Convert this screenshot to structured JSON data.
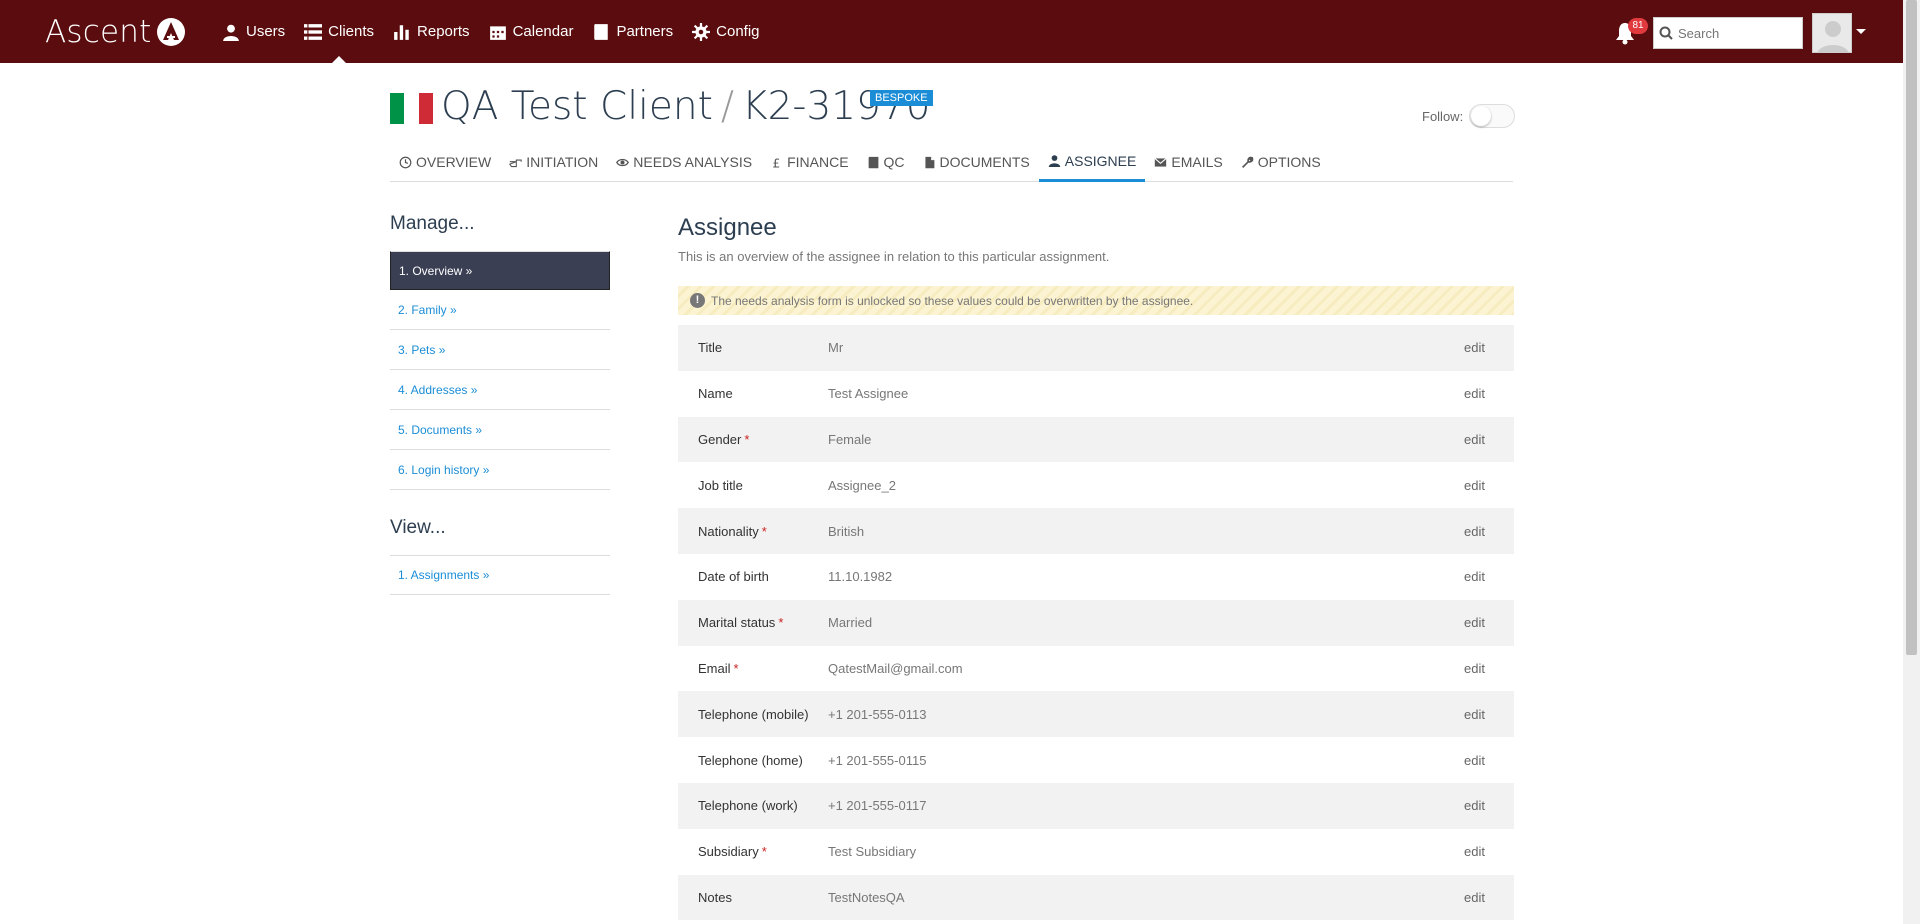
{
  "app": {
    "logo_text": "Ascent",
    "nav": [
      {
        "label": "Users",
        "icon": "user-icon"
      },
      {
        "label": "Clients",
        "icon": "list-icon"
      },
      {
        "label": "Reports",
        "icon": "bar-chart-icon"
      },
      {
        "label": "Calendar",
        "icon": "calendar-icon"
      },
      {
        "label": "Partners",
        "icon": "book-icon"
      },
      {
        "label": "Config",
        "icon": "gear-icon"
      }
    ],
    "active_nav": "Clients",
    "notifications_count": "81",
    "search_placeholder": "Search"
  },
  "header": {
    "client": "QA Test Client",
    "separator": "/",
    "case_ref": "K2-31970",
    "badge": "BESPOKE",
    "follow_label": "Follow:",
    "flag_colors": [
      "#009246",
      "#ffffff",
      "#ce2b37"
    ]
  },
  "tabs": [
    {
      "label": "OVERVIEW",
      "icon": "clock-icon"
    },
    {
      "label": "INITIATION",
      "icon": "hand-pointer-icon"
    },
    {
      "label": "NEEDS ANALYSIS",
      "icon": "eye-icon"
    },
    {
      "label": "FINANCE",
      "icon": "pound-icon"
    },
    {
      "label": "QC",
      "icon": "book-icon"
    },
    {
      "label": "DOCUMENTS",
      "icon": "file-icon"
    },
    {
      "label": "ASSIGNEE",
      "icon": "user-icon"
    },
    {
      "label": "EMAILS",
      "icon": "envelope-icon"
    },
    {
      "label": "OPTIONS",
      "icon": "wrench-icon"
    }
  ],
  "active_tab": "ASSIGNEE",
  "sidebar": {
    "manage_heading": "Manage...",
    "manage_items": [
      "1. Overview »",
      "2. Family »",
      "3. Pets »",
      "4. Addresses »",
      "5. Documents »",
      "6. Login history »"
    ],
    "view_heading": "View...",
    "view_items": [
      "1. Assignments »"
    ]
  },
  "main": {
    "heading": "Assignee",
    "description": "This is an overview of the assignee in relation to this particular assignment.",
    "warning": "The needs analysis form is unlocked so these values could be overwritten by the assignee.",
    "edit_label": "edit",
    "fields": [
      {
        "label": "Title",
        "required": false,
        "value": "Mr"
      },
      {
        "label": "Name",
        "required": false,
        "value": "Test Assignee"
      },
      {
        "label": "Gender",
        "required": true,
        "value": "Female"
      },
      {
        "label": "Job title",
        "required": false,
        "value": "Assignee_2"
      },
      {
        "label": "Nationality",
        "required": true,
        "value": "British"
      },
      {
        "label": "Date of birth",
        "required": false,
        "value": "11.10.1982"
      },
      {
        "label": "Marital status",
        "required": true,
        "value": "Married"
      },
      {
        "label": "Email",
        "required": true,
        "value": "QatestMail@gmail.com"
      },
      {
        "label": "Telephone (mobile)",
        "required": false,
        "value": "+1 201-555-0113"
      },
      {
        "label": "Telephone (home)",
        "required": false,
        "value": "+1 201-555-0115"
      },
      {
        "label": "Telephone (work)",
        "required": false,
        "value": "+1 201-555-0117"
      },
      {
        "label": "Subsidiary",
        "required": true,
        "value": "Test Subsidiary"
      },
      {
        "label": "Notes",
        "required": false,
        "value": "TestNotesQA"
      }
    ]
  },
  "colors": {
    "topbar": "#5a0c0e",
    "accent": "#1b8dd6",
    "sidebar_active": "#3a3f54",
    "required": "#cc2222"
  }
}
